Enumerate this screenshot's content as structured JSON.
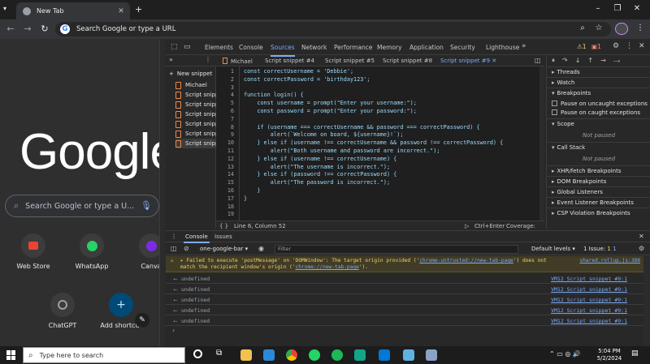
{
  "browser": {
    "tab_title": "New Tab",
    "omnibox_placeholder": "Search Google or type a URL"
  },
  "newtab": {
    "logo": "Google",
    "search_placeholder": "Search Google or type a U...",
    "shortcuts": [
      {
        "label": "Web Store",
        "icon": "web-store-icon"
      },
      {
        "label": "WhatsApp",
        "icon": "whatsapp-icon"
      },
      {
        "label": "Canva",
        "icon": "canva-icon"
      },
      {
        "label": "ChatGPT",
        "icon": "chatgpt-icon"
      },
      {
        "label": "Add shortcut",
        "icon": "plus-icon"
      }
    ]
  },
  "devtools": {
    "tabs": [
      "Elements",
      "Console",
      "Sources",
      "Network",
      "Performance",
      "Memory",
      "Application",
      "Security",
      "Lighthouse"
    ],
    "active_tab": "Sources",
    "warning_count": "1",
    "error_count": "1",
    "new_snippet_label": "New snippet",
    "snippets": [
      "Michael",
      "Script snipp",
      "Script snipp",
      "Script snipp",
      "Script snipp",
      "Script snipp",
      "Script snipp"
    ],
    "editor_tabs": [
      "Michael",
      "Script snippet #4",
      "Script snippet #5",
      "Script snippet #8",
      "Script snippet #9"
    ],
    "active_editor_tab": "Script snippet #9",
    "code_lines": [
      "const correctUsername = 'Debbie';",
      "const correctPassword = 'birthday123';",
      "",
      "function login() {",
      "    const username = prompt(\"Enter your username:\");",
      "    const password = prompt(\"Enter your password:\");",
      "",
      "    if (username === correctUsername && password === correctPassword) {",
      "        alert(`Welcome on board, ${username}!`);",
      "    } else if (username !== correctUsername && password !== correctPassword) {",
      "        alert(\"Both username and password are incorrect.\");",
      "    } else if (username !== correctUsername) {",
      "        alert(\"The username is incorrect.\");",
      "    } else if (password !== correctPassword) {",
      "        alert(\"The password is incorrect.\");",
      "    }",
      "}",
      "",
      ""
    ],
    "status_position": "Line 6, Column 52",
    "status_run": "Ctrl+Enter",
    "status_coverage": "Coverage: n/a",
    "debugger": {
      "threads": "Threads",
      "watch": "Watch",
      "breakpoints": "Breakpoints",
      "pause_uncaught": "Pause on uncaught exceptions",
      "pause_caught": "Pause on caught exceptions",
      "scope": "Scope",
      "not_paused_1": "Not paused",
      "call_stack": "Call Stack",
      "not_paused_2": "Not paused",
      "xhr": "XHR/fetch Breakpoints",
      "dom": "DOM Breakpoints",
      "global": "Global Listeners",
      "event": "Event Listener Breakpoints",
      "csp": "CSP Violation Breakpoints"
    },
    "drawer": {
      "tabs": [
        "Console",
        "Issues"
      ],
      "context": "one-google-bar",
      "filter_placeholder": "Filter",
      "levels": "Default levels",
      "issues": "1 Issue:",
      "issue_warn": "1",
      "issue_info": "1",
      "warning_line1": "▸ Failed to execute 'postMessage' on 'DOMWindow': The target origin provided ('",
      "warning_link1": "chrome-untrusted://new-tab-page",
      "warning_mid": "') does not",
      "warning_src": "shared.rollup.js:388",
      "warning_line2a": "match the recipient window's origin ('",
      "warning_link2": "chrome://new-tab-page",
      "warning_line2b": "').",
      "rows": [
        {
          "value": "undefined",
          "source": "VM12 Script snippet #9:1"
        },
        {
          "value": "undefined",
          "source": "VM12 Script snippet #9:1"
        },
        {
          "value": "undefined",
          "source": "VM12 Script snippet #9:1"
        },
        {
          "value": "undefined",
          "source": "VM12 Script snippet #9:1"
        },
        {
          "value": "undefined",
          "source": "VM12 Script snippet #9:1"
        }
      ]
    }
  },
  "taskbar": {
    "search_placeholder": "Type here to search",
    "time": "5:04 PM",
    "date": "5/2/2024"
  },
  "colors": {
    "accent": "#7cacf8",
    "warning_bg": "#413c26",
    "warning_text": "#f2d06b",
    "string": "#f28b82",
    "keyword": "#c586c0"
  }
}
